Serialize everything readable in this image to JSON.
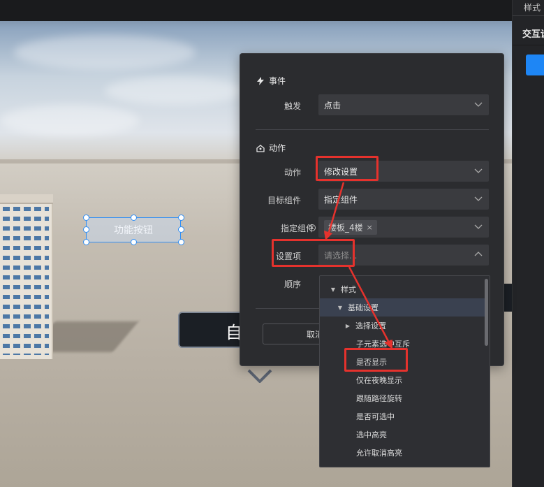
{
  "scene": {
    "function_button_label": "功能按钮",
    "background_label": "自"
  },
  "side_panel": {
    "tab_style": "样式",
    "tab_interaction": "交互设"
  },
  "panel": {
    "event_section": {
      "title": "事件",
      "icon": "lightning-icon"
    },
    "trigger": {
      "label": "触发",
      "value": "点击"
    },
    "action_section": {
      "title": "动作",
      "icon": "action-icon"
    },
    "action": {
      "label": "动作",
      "value": "修改设置"
    },
    "target_component": {
      "label": "目标组件",
      "value": "指定组件"
    },
    "specified_component": {
      "label": "指定组件",
      "tag": "楼板_4楼",
      "tag_close": "×"
    },
    "setting_item": {
      "label": "设置项",
      "placeholder": "请选择..."
    },
    "order": {
      "label": "顺序"
    },
    "cancel_label": "取消"
  },
  "dropdown": {
    "items": [
      {
        "label": "样式",
        "arrow": "▼"
      },
      {
        "label": "基础设置",
        "arrow": "▼"
      },
      {
        "label": "选择设置",
        "arrow": "▶"
      },
      {
        "label": "子元素选中互斥",
        "arrow": ""
      },
      {
        "label": "是否显示",
        "arrow": ""
      },
      {
        "label": "仅在夜晚显示",
        "arrow": ""
      },
      {
        "label": "跟随路径旋转",
        "arrow": ""
      },
      {
        "label": "是否可选中",
        "arrow": ""
      },
      {
        "label": "选中高亮",
        "arrow": ""
      },
      {
        "label": "允许取消高亮",
        "arrow": ""
      }
    ]
  },
  "colors": {
    "accent": "#2f8ef5",
    "annotation_red": "#e5322d",
    "panel_bg": "#2b2c2f"
  }
}
